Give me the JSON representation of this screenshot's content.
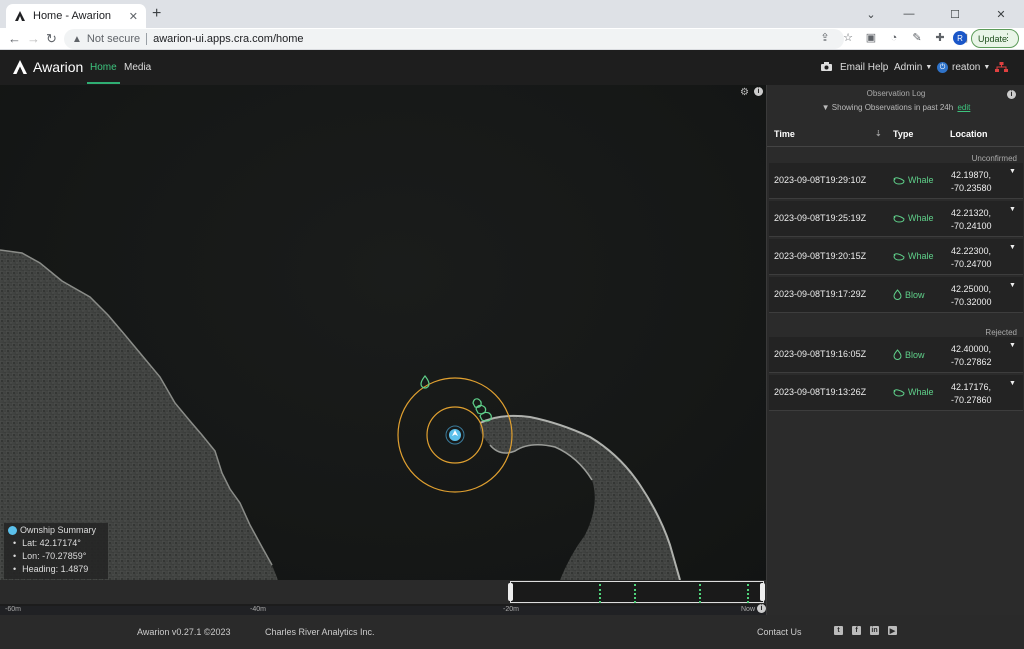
{
  "browser": {
    "tab_title": "Home - Awarion",
    "tab_close": "✕",
    "new_tab": "+",
    "win_chevron": "⌄",
    "win_minimize": "—",
    "win_maximize": "☐",
    "win_close": "✕",
    "back": "←",
    "forward": "→",
    "reload": "↻",
    "security_label": "Not secure",
    "url": "awarion-ui.apps.cra.com/home",
    "profile_initial": "R",
    "update_label": "Update"
  },
  "app": {
    "logo_text": "Awarion",
    "nav": [
      {
        "label": "Home",
        "active": true
      },
      {
        "label": "Media",
        "active": false
      }
    ],
    "email_help": "Email Help",
    "admin": "Admin",
    "user": "reaton"
  },
  "map": {
    "ownship_summary": {
      "title": "Ownship Summary",
      "lat": "Lat: 42.17174°",
      "lon": "Lon: -70.27859°",
      "heading": "Heading: 1.4879"
    }
  },
  "timeline": {
    "labels": [
      "-60m",
      "-40m",
      "-20m",
      "Now"
    ]
  },
  "observation_log": {
    "title": "Observation Log",
    "filter_text": "Showing Observations in past 24h",
    "edit_label": "edit",
    "columns": {
      "time": "Time",
      "type": "Type",
      "location": "Location"
    },
    "unconfirmed_label": "Unconfirmed",
    "rejected_label": "Rejected",
    "unconfirmed": [
      {
        "time": "2023-09-08T19:29:10Z",
        "type": "Whale",
        "lat": "42.19870,",
        "lon": "-70.23580"
      },
      {
        "time": "2023-09-08T19:25:19Z",
        "type": "Whale",
        "lat": "42.21320,",
        "lon": "-70.24100"
      },
      {
        "time": "2023-09-08T19:20:15Z",
        "type": "Whale",
        "lat": "42.22300,",
        "lon": "-70.24700"
      },
      {
        "time": "2023-09-08T19:17:29Z",
        "type": "Blow",
        "lat": "42.25000,",
        "lon": "-70.32000"
      }
    ],
    "rejected": [
      {
        "time": "2023-09-08T19:16:05Z",
        "type": "Blow",
        "lat": "42.40000,",
        "lon": "-70.27862"
      },
      {
        "time": "2023-09-08T19:13:26Z",
        "type": "Whale",
        "lat": "42.17176,",
        "lon": "-70.27860"
      }
    ]
  },
  "footer": {
    "version": "Awarion v0.27.1 ©2023",
    "company": "Charles River Analytics Inc.",
    "contact": "Contact Us"
  },
  "colors": {
    "accent": "#3dc47e",
    "detection": "#5fd08a",
    "range_ring": "#e0a030",
    "ownship": "#5bc0eb"
  }
}
